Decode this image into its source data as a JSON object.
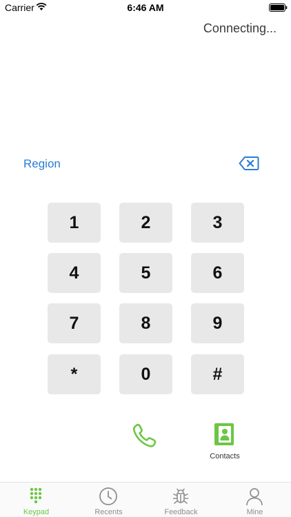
{
  "status_bar": {
    "carrier": "Carrier",
    "time": "6:46 AM"
  },
  "call_status": "Connecting...",
  "region_label": "Region",
  "keypad": {
    "keys": [
      "1",
      "2",
      "3",
      "4",
      "5",
      "6",
      "7",
      "8",
      "9",
      "*",
      "0",
      "#"
    ]
  },
  "actions": {
    "contacts_label": "Contacts"
  },
  "colors": {
    "accent": "#6cc644",
    "link": "#2a7cd4",
    "key_bg": "#e8e8e8"
  },
  "tabs": [
    {
      "label": "Keypad",
      "icon": "keypad-icon",
      "active": true
    },
    {
      "label": "Recents",
      "icon": "clock-icon",
      "active": false
    },
    {
      "label": "Feedback",
      "icon": "bug-icon",
      "active": false
    },
    {
      "label": "Mine",
      "icon": "person-icon",
      "active": false
    }
  ]
}
